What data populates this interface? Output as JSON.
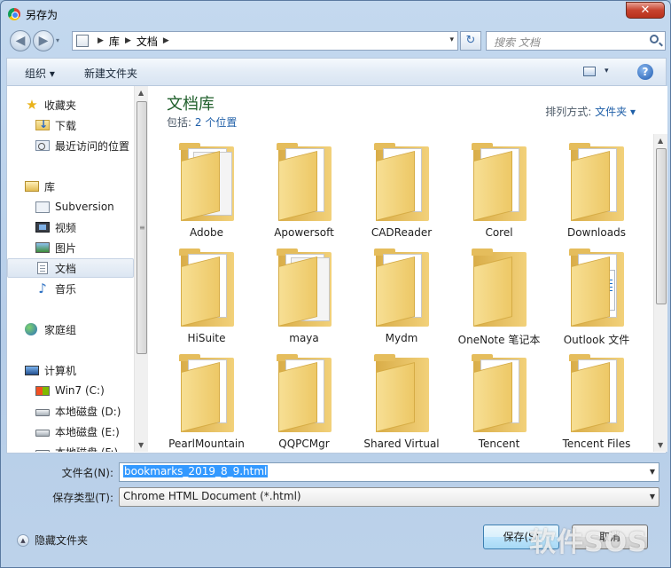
{
  "window": {
    "title": "另存为",
    "close_glyph": "✕"
  },
  "nav": {
    "back_glyph": "◀",
    "forward_glyph": "▶",
    "dropdown_glyph": "▾"
  },
  "address": {
    "crumbs": [
      "库",
      "文档"
    ],
    "separator": "▶",
    "dropdown_glyph": "▾",
    "refresh_glyph": "↻"
  },
  "search": {
    "placeholder": "搜索 文档"
  },
  "toolbar": {
    "organize": "组织 ▾",
    "new_folder": "新建文件夹",
    "view_dropdown": "▾",
    "help": "?"
  },
  "sidebar": {
    "items": [
      {
        "label": "收藏夹",
        "icon": "star-icon"
      },
      {
        "label": "下载",
        "icon": "downloads-folder-icon"
      },
      {
        "label": "最近访问的位置",
        "icon": "recent-places-icon"
      },
      {
        "label": "库",
        "icon": "libraries-icon"
      },
      {
        "label": "Subversion",
        "icon": "subversion-icon"
      },
      {
        "label": "视频",
        "icon": "videos-icon"
      },
      {
        "label": "图片",
        "icon": "pictures-icon"
      },
      {
        "label": "文档",
        "icon": "documents-icon",
        "selected": true
      },
      {
        "label": "音乐",
        "icon": "music-icon"
      },
      {
        "label": "家庭组",
        "icon": "homegroup-icon"
      },
      {
        "label": "计算机",
        "icon": "computer-icon"
      },
      {
        "label": "Win7 (C:)",
        "icon": "system-drive-icon"
      },
      {
        "label": "本地磁盘 (D:)",
        "icon": "disk-drive-icon"
      },
      {
        "label": "本地磁盘 (E:)",
        "icon": "disk-drive-icon"
      },
      {
        "label": "本地磁盘 (F:)",
        "icon": "disk-drive-icon"
      }
    ],
    "scroll_up": "▲",
    "scroll_down": "▼",
    "scroll_grip": "≡"
  },
  "library": {
    "title": "文档库",
    "includes_label": "包括:",
    "includes_link": "2 个位置",
    "arrange_label": "排列方式:",
    "arrange_value": "文件夹 ▾"
  },
  "files": [
    {
      "name": "Adobe",
      "kind": "paper"
    },
    {
      "name": "Apowersoft",
      "kind": "folder"
    },
    {
      "name": "CADReader",
      "kind": "folder"
    },
    {
      "name": "Corel",
      "kind": "folder"
    },
    {
      "name": "Downloads",
      "kind": "folder"
    },
    {
      "name": "HiSuite",
      "kind": "folder"
    },
    {
      "name": "maya",
      "kind": "paper"
    },
    {
      "name": "Mydm",
      "kind": "folder"
    },
    {
      "name": "OneNote 笔记本",
      "kind": "empty"
    },
    {
      "name": "Outlook 文件",
      "kind": "outlook"
    },
    {
      "name": "PearlMountain",
      "kind": "folder"
    },
    {
      "name": "QQPCMgr",
      "kind": "folder"
    },
    {
      "name": "Shared Virtual",
      "kind": "empty"
    },
    {
      "name": "Tencent",
      "kind": "folder"
    },
    {
      "name": "Tencent Files",
      "kind": "folder"
    }
  ],
  "content_scroll": {
    "up": "▲",
    "down": "▼"
  },
  "form": {
    "filename_label": "文件名(N):",
    "filename_value": "bookmarks_2019_8_9.html",
    "filetype_label": "保存类型(T):",
    "filetype_value": "Chrome HTML Document (*.html)",
    "dropdown_glyph": "▼"
  },
  "footer": {
    "hide_folders": "隐藏文件夹",
    "hide_folders_glyph": "▲",
    "save": "保存(S)",
    "cancel": "取消"
  },
  "watermark": "软件SOS"
}
